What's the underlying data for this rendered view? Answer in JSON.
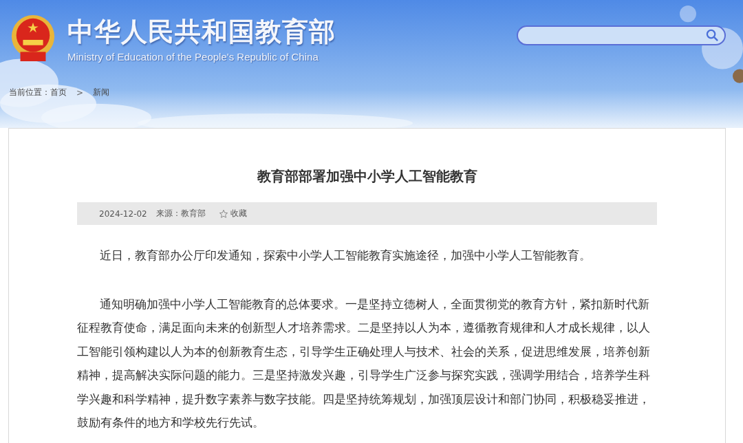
{
  "header": {
    "title": "中华人民共和国教育部",
    "subtitle": "Ministry of Education of the People's Republic of China"
  },
  "breadcrumb": {
    "label": "当前位置：",
    "items": [
      "首页",
      "新闻"
    ],
    "separator": ">"
  },
  "article": {
    "title": "教育部部署加强中小学人工智能教育",
    "date": "2024-12-02",
    "source": "来源：教育部",
    "favorite": "收藏",
    "paragraphs": [
      "近日，教育部办公厅印发通知，探索中小学人工智能教育实施途径，加强中小学人工智能教育。",
      "通知明确加强中小学人工智能教育的总体要求。一是坚持立德树人，全面贯彻党的教育方针，紧扣新时代新征程教育使命，满足面向未来的创新型人才培养需求。二是坚持以人为本，遵循教育规律和人才成长规律，以人工智能引领构建以人为本的创新教育生态，引导学生正确处理人与技术、社会的关系，促进思维发展，培养创新精神，提高解决实际问题的能力。三是坚持激发兴趣，引导学生广泛参与探究实践，强调学用结合，培养学生科学兴趣和科学精神，提升数字素养与数字技能。四是坚持统筹规划，加强顶层设计和部门协同，积极稳妥推进，鼓励有条件的地方和学校先行先试。"
    ]
  }
}
